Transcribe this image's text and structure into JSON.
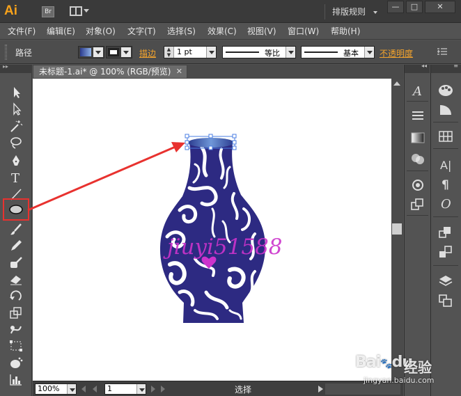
{
  "app": {
    "logo_text": "Ai",
    "bridge_label": "Br",
    "workspace": "排版规则",
    "window_buttons": {
      "minimize": "—",
      "maximize": "□",
      "close": "✕"
    }
  },
  "menu": {
    "items": [
      {
        "label": "文件(F)"
      },
      {
        "label": "编辑(E)"
      },
      {
        "label": "对象(O)"
      },
      {
        "label": "文字(T)"
      },
      {
        "label": "选择(S)"
      },
      {
        "label": "效果(C)"
      },
      {
        "label": "视图(V)"
      },
      {
        "label": "窗口(W)"
      },
      {
        "label": "帮助(H)"
      }
    ]
  },
  "control": {
    "selection_type": "路径",
    "stroke_label": "描边",
    "stroke_weight": "1 pt",
    "profile_label": "等比",
    "brush_label": "基本",
    "opacity_label": "不透明度",
    "fill_icon": "gradient-swatch",
    "stroke_icon": "stroke-swatch"
  },
  "document": {
    "tab_title": "未标题-1.ai* @ 100% (RGB/预览)",
    "tab_close": "✕",
    "artwork_text": "jiuyi51588",
    "artwork_colors": {
      "vase": "#2d2a82",
      "rim_light": "#7fa7e0",
      "text": "#cc33cc",
      "annotation": "#e8322f"
    }
  },
  "status": {
    "zoom": "100%",
    "page": "1",
    "tool_name": "选择"
  },
  "tools": [
    "selection-tool-icon",
    "direct-selection-tool-icon",
    "magic-wand-tool-icon",
    "lasso-tool-icon",
    "pen-tool-icon",
    "type-tool-icon",
    "line-segment-tool-icon",
    "ellipse-tool-icon",
    "paintbrush-tool-icon",
    "pencil-tool-icon",
    "blob-brush-tool-icon",
    "eraser-tool-icon",
    "rotate-tool-icon",
    "scale-tool-icon",
    "warp-tool-icon",
    "free-transform-tool-icon",
    "symbol-sprayer-tool-icon",
    "graph-tool-icon"
  ],
  "type_tool_glyph": "T",
  "dock_a": {
    "icons": [
      "character-styles-icon",
      "align-icon",
      "gradient-icon",
      "transparency-icon",
      "symbols-icon",
      "links-icon"
    ],
    "glyph": "A"
  },
  "dock_b": {
    "icons": [
      "color-icon",
      "color-guide-icon",
      "swatches-grid-icon",
      "character-icon",
      "paragraph-icon",
      "opentype-icon",
      "graphic-styles-icon",
      "appearance-icon",
      "layers-icon",
      "artboards-icon"
    ],
    "char_glyph": "A|",
    "para_glyph": "¶",
    "opentype_glyph": "O"
  },
  "watermark": {
    "brand": "Bai",
    "brand_suffix": "du",
    "sub": "经验",
    "url": "jingyan.baidu.com"
  }
}
